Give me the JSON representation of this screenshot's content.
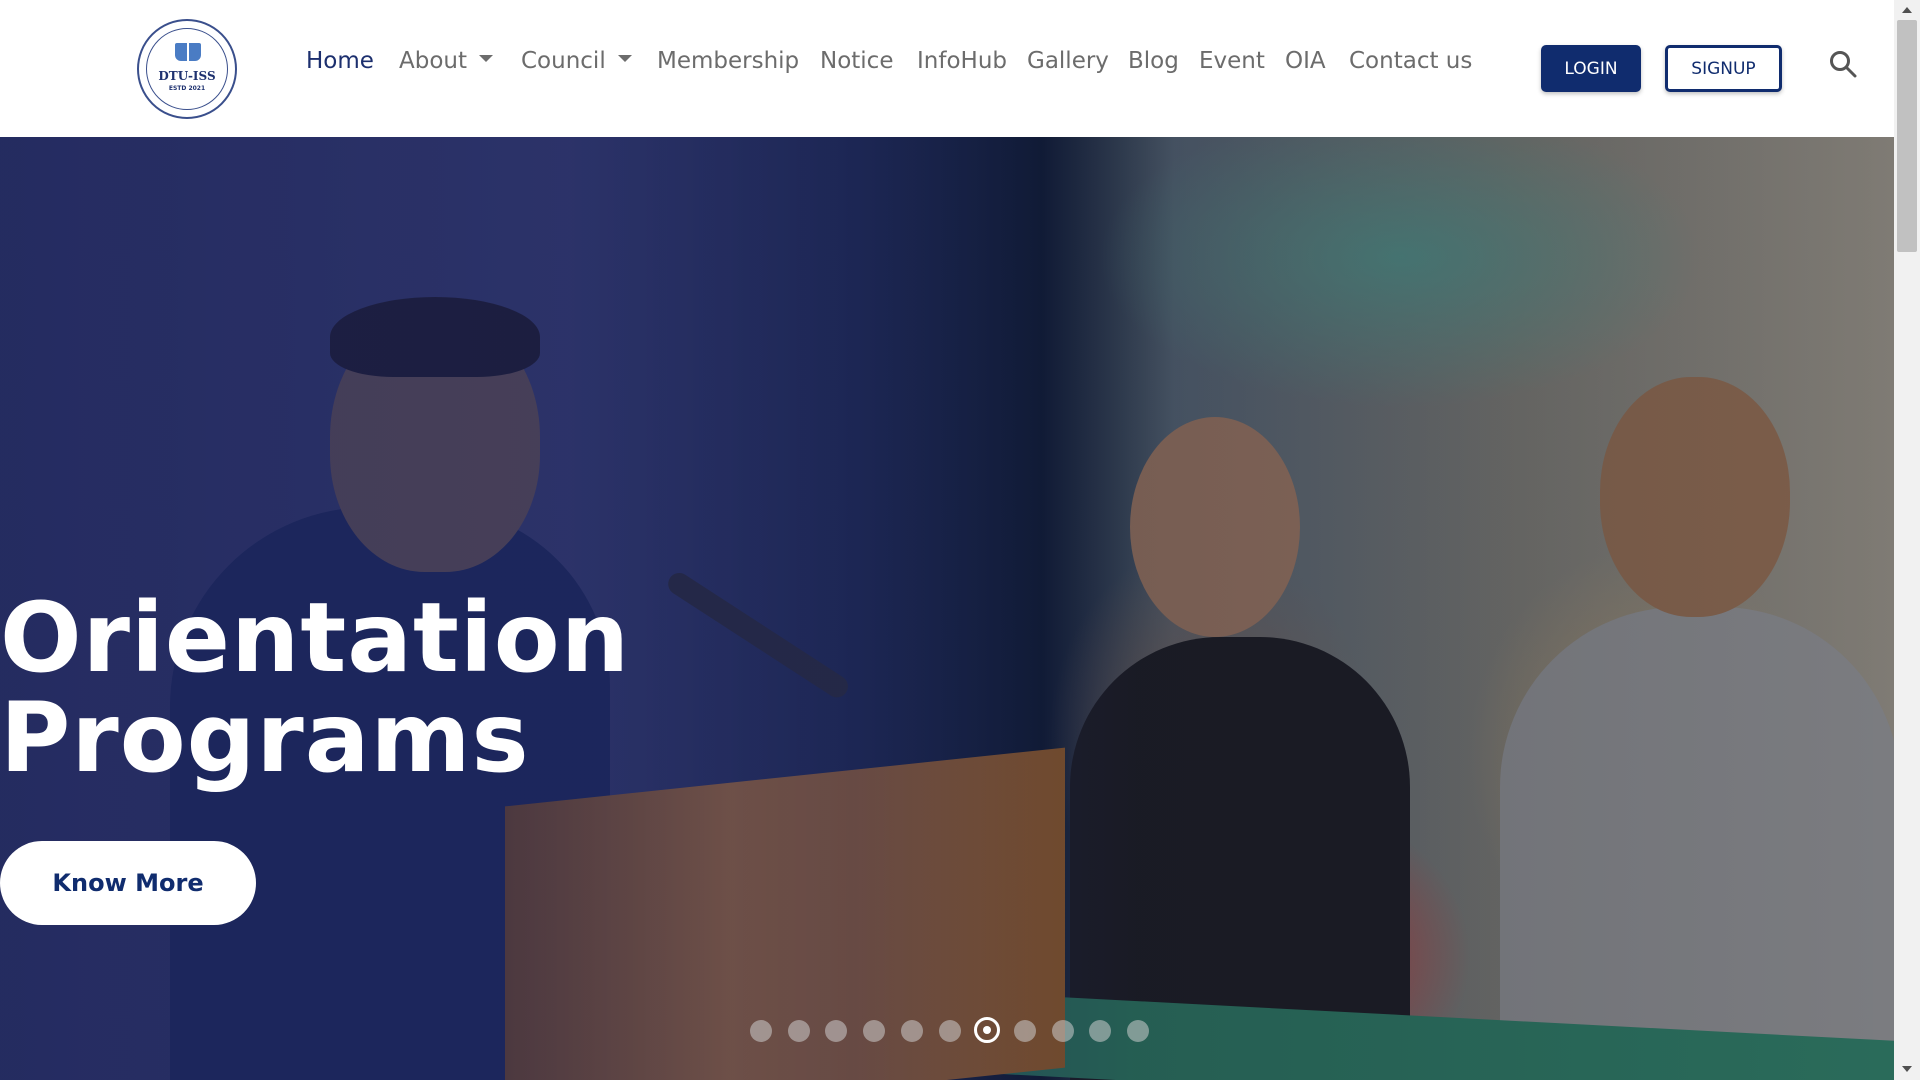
{
  "header": {
    "logo": {
      "name": "DTU-ISS",
      "estd": "ESTD 2021",
      "ring_text": "Delhi Technological University · International Students Society"
    },
    "nav": [
      {
        "label": "Home",
        "active": true,
        "dropdown": false
      },
      {
        "label": "About",
        "active": false,
        "dropdown": true
      },
      {
        "label": "Council",
        "active": false,
        "dropdown": true
      },
      {
        "label": "Membership",
        "active": false,
        "dropdown": false
      },
      {
        "label": "Notice",
        "active": false,
        "dropdown": false
      },
      {
        "label": "InfoHub",
        "active": false,
        "dropdown": false
      },
      {
        "label": "Gallery",
        "active": false,
        "dropdown": false
      },
      {
        "label": "Blog",
        "active": false,
        "dropdown": false
      },
      {
        "label": "Event",
        "active": false,
        "dropdown": false
      },
      {
        "label": "OIA",
        "active": false,
        "dropdown": false
      },
      {
        "label": "Contact us",
        "active": false,
        "dropdown": false
      }
    ],
    "login_label": "LOGIN",
    "signup_label": "SIGNUP",
    "search_icon": "search-icon"
  },
  "hero": {
    "title_line1": "Orientation",
    "title_line2": "Programs",
    "cta_label": "Know More",
    "carousel": {
      "total_slides": 11,
      "active_index": 6
    }
  },
  "colors": {
    "brand": "#102c6e",
    "nav_text": "#6c6c6c",
    "nav_active": "#1c2f6e"
  }
}
